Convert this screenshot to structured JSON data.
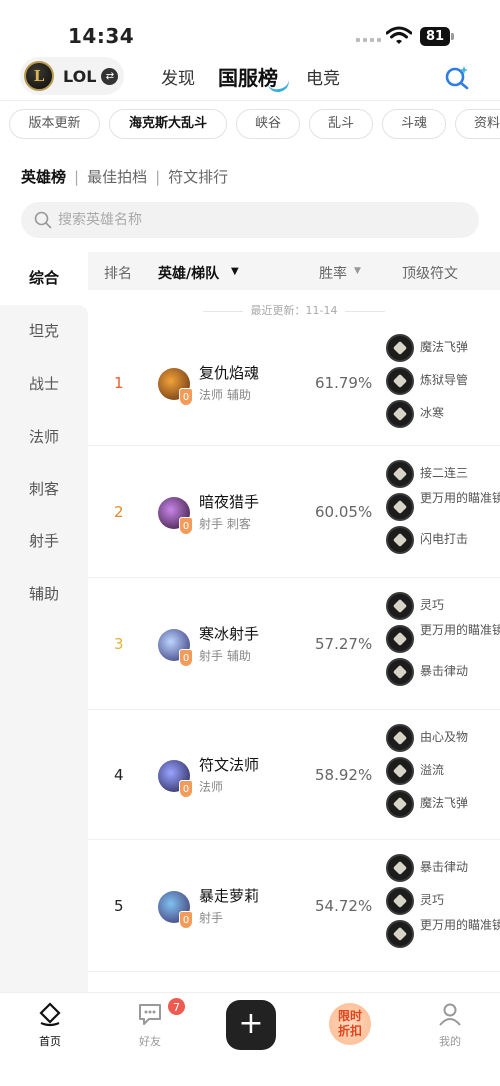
{
  "status_bar": {
    "time": "14:34",
    "battery": "81"
  },
  "top_nav": {
    "game_name": "LOL",
    "tabs": [
      {
        "label": "发现"
      },
      {
        "label": "国服榜"
      },
      {
        "label": "电竞"
      }
    ]
  },
  "mode_chips": [
    {
      "label": "版本更新"
    },
    {
      "label": "海克斯大乱斗"
    },
    {
      "label": "峡谷"
    },
    {
      "label": "乱斗"
    },
    {
      "label": "斗魂"
    },
    {
      "label": "资料"
    }
  ],
  "sub_tabs": [
    {
      "label": "英雄榜"
    },
    {
      "label": "最佳拍档"
    },
    {
      "label": "符文排行"
    }
  ],
  "search": {
    "placeholder": "搜索英雄名称"
  },
  "sidebar": {
    "items": [
      {
        "label": "综合"
      },
      {
        "label": "坦克"
      },
      {
        "label": "战士"
      },
      {
        "label": "法师"
      },
      {
        "label": "刺客"
      },
      {
        "label": "射手"
      },
      {
        "label": "辅助"
      }
    ]
  },
  "table": {
    "headers": {
      "rank": "排名",
      "hero": "英雄/梯队",
      "win_rate": "胜率",
      "runes": "顶级符文"
    },
    "last_update": "最近更新：11-14",
    "rows": [
      {
        "rank": "1",
        "rank_color": "#e8612c",
        "name": "复仇焰魂",
        "roles": "法师 辅助",
        "tier": "0",
        "win_rate": "61.79%",
        "runes": [
          "魔法飞弹",
          "炼狱导管",
          "冰寒"
        ]
      },
      {
        "rank": "2",
        "rank_color": "#e8892c",
        "name": "暗夜猎手",
        "roles": "射手 刺客",
        "tier": "0",
        "win_rate": "60.05%",
        "runes": [
          "接二连三",
          "更万用的瞄准镜",
          "闪电打击"
        ]
      },
      {
        "rank": "3",
        "rank_color": "#e6b23a",
        "name": "寒冰射手",
        "roles": "射手 辅助",
        "tier": "0",
        "win_rate": "57.27%",
        "runes": [
          "灵巧",
          "更万用的瞄准镜",
          "暴击律动"
        ]
      },
      {
        "rank": "4",
        "rank_color": "#222222",
        "name": "符文法师",
        "roles": "法师",
        "tier": "0",
        "win_rate": "58.92%",
        "runes": [
          "由心及物",
          "溢流",
          "魔法飞弹"
        ]
      },
      {
        "rank": "5",
        "rank_color": "#222222",
        "name": "暴走萝莉",
        "roles": "射手",
        "tier": "0",
        "win_rate": "54.72%",
        "runes": [
          "暴击律动",
          "灵巧",
          "更万用的瞄准镜"
        ]
      }
    ]
  },
  "bottom_nav": {
    "home": "首页",
    "friends": "好友",
    "friends_badge": "7",
    "promo_line1": "限时",
    "promo_line2": "折扣",
    "me": "我的"
  }
}
